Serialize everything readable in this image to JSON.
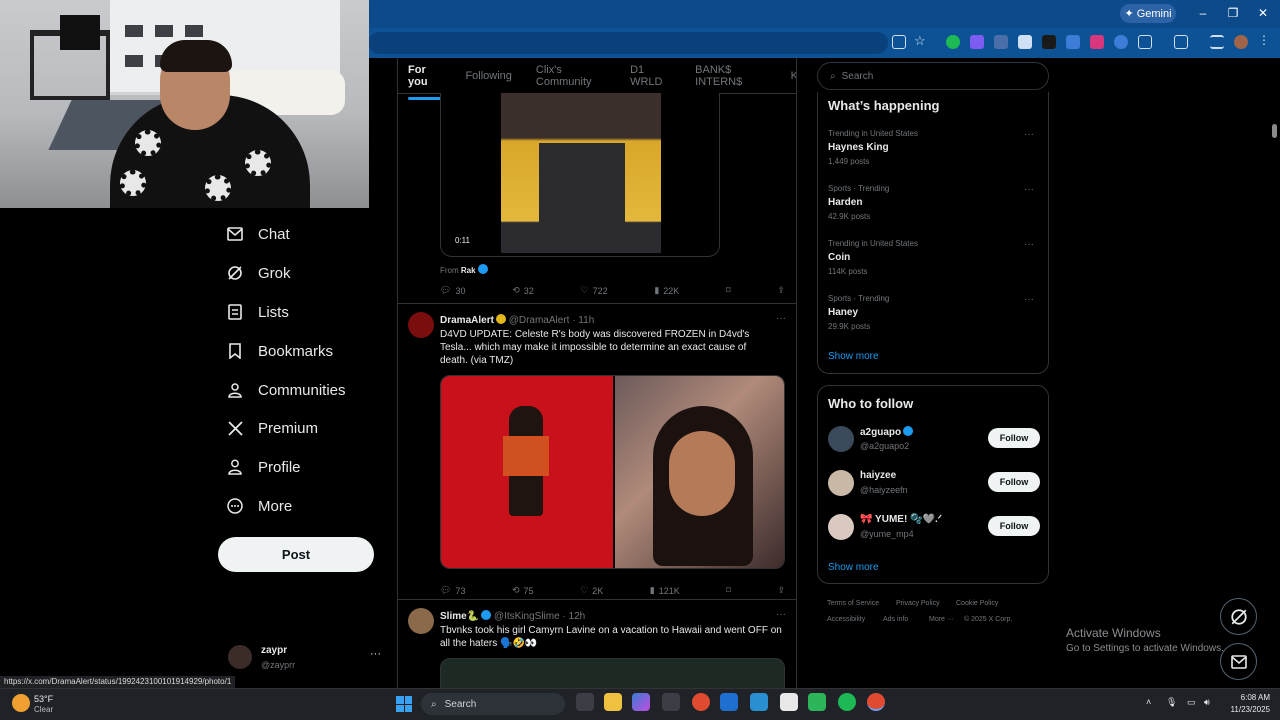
{
  "browser": {
    "gemini_label": "Gemini",
    "window_controls": [
      "–",
      "❐",
      "✕"
    ]
  },
  "nav": {
    "items": [
      {
        "label": "Chat",
        "icon": "mail-icon"
      },
      {
        "label": "Grok",
        "icon": "grok-icon"
      },
      {
        "label": "Lists",
        "icon": "list-icon"
      },
      {
        "label": "Bookmarks",
        "icon": "bookmark-icon"
      },
      {
        "label": "Communities",
        "icon": "communities-icon"
      },
      {
        "label": "Premium",
        "icon": "x-icon"
      },
      {
        "label": "Profile",
        "icon": "person-icon"
      },
      {
        "label": "More",
        "icon": "more-circle-icon"
      }
    ],
    "post_label": "Post",
    "account": {
      "name": "zaypr",
      "handle": "@zayprr"
    }
  },
  "tabs": [
    "For you",
    "Following",
    "Clix's Community",
    "D1 WRLD",
    "BANK$ INTERN$",
    "K"
  ],
  "posts": [
    {
      "video_time": "0:11",
      "from_label": "From",
      "from_name": "Rak",
      "replies": "30",
      "reposts": "32",
      "likes": "722",
      "views": "22K"
    },
    {
      "name": "DramaAlert",
      "handle": "@DramaAlert · 11h",
      "avatar_text": "DramaAlert",
      "text": "D4VD UPDATE: Celeste R's body was discovered FROZEN in D4vd's Tesla... which may make it impossible to determine an exact cause of death. (via TMZ)",
      "replies": "73",
      "reposts": "75",
      "likes": "2K",
      "views": "121K"
    },
    {
      "name": "Slime🐍",
      "handle": "@ItsKingSlime · 12h",
      "text": "Tbvnks took his girl Camyrn Lavine on a vacation to Hawaii and went OFF on all the haters 🗣️🤣👀"
    }
  ],
  "right": {
    "search_placeholder": "Search",
    "whats_happening_title": "What’s happening",
    "trends": [
      {
        "category": "Trending in United States",
        "name": "Haynes King",
        "count": "1,449 posts"
      },
      {
        "category": "Sports · Trending",
        "name": "Harden",
        "count": "42.9K posts"
      },
      {
        "category": "Trending in United States",
        "name": "Coin",
        "count": "114K posts"
      },
      {
        "category": "Sports · Trending",
        "name": "Haney",
        "count": "29.9K posts"
      }
    ],
    "show_more": "Show more",
    "who_to_follow_title": "Who to follow",
    "follow_suggestions": [
      {
        "name": "a2guapo",
        "handle": "@a2guapo2",
        "button": "Follow"
      },
      {
        "name": "haiyzee",
        "handle": "@haiyzeefn",
        "button": "Follow"
      },
      {
        "name": "🎀 YUME! 🫧🩶.ᐟ",
        "handle": "@yume_mp4",
        "button": "Follow"
      }
    ],
    "footer": [
      "Terms of Service",
      "Privacy Policy",
      "Cookie Policy",
      "Accessibility",
      "Ads info",
      "More ···",
      "© 2025 X Corp."
    ]
  },
  "activate": {
    "title": "Activate Windows",
    "subtitle": "Go to Settings to activate Windows."
  },
  "status_url": "https://x.com/DramaAlert/status/1992423100101914929/photo/1",
  "taskbar": {
    "weather_temp": "53°F",
    "weather_desc": "Clear",
    "search_label": "Search",
    "time": "6:08 AM",
    "date": "11/23/2025"
  },
  "colors": {
    "accent": "#1d9bf0",
    "browser_frame": "#0c4a8a"
  }
}
